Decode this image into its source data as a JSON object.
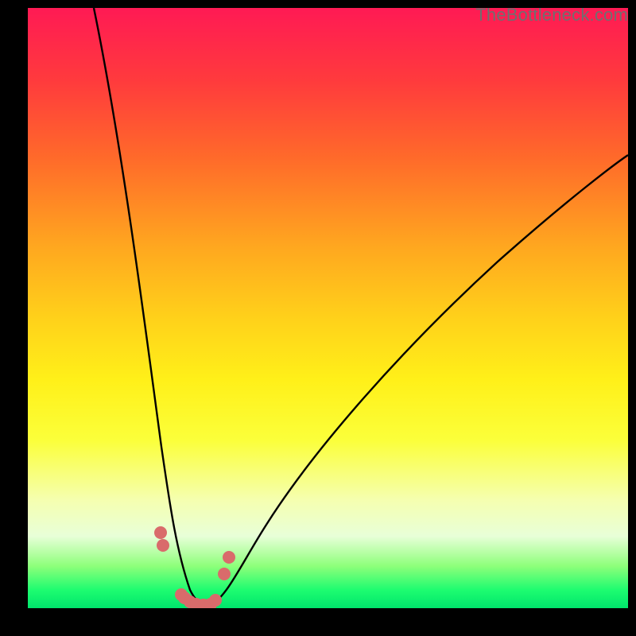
{
  "watermark": "TheBottleneck.com",
  "colors": {
    "background": "#000000",
    "curve": "#000000",
    "markers": "#d96b6b",
    "gradient_stops": [
      "#ff1a54",
      "#ff3a3d",
      "#ff6a2a",
      "#ffa81f",
      "#ffd21a",
      "#fff019",
      "#fbff3a",
      "#f5ffb0",
      "#e8ffd8",
      "#8dff7a",
      "#1dfc70",
      "#00e56c"
    ]
  },
  "chart_data": {
    "type": "line",
    "title": "",
    "xlabel": "",
    "ylabel": "",
    "xlim": [
      0,
      100
    ],
    "ylim": [
      0,
      100
    ],
    "series": [
      {
        "name": "bottleneck-curve",
        "x": [
          11,
          13,
          15,
          17,
          19,
          21,
          22,
          23,
          24,
          25,
          26,
          27,
          28,
          29,
          30,
          32,
          34,
          37,
          40,
          45,
          51,
          58,
          66,
          75,
          85,
          95,
          100
        ],
        "values": [
          100,
          89,
          78,
          67,
          56,
          44,
          37,
          30,
          22,
          14,
          7,
          3,
          1,
          0,
          0,
          1,
          3,
          6,
          10,
          17,
          25,
          33,
          42,
          51,
          60,
          68,
          72
        ]
      }
    ],
    "markers": {
      "name": "highlight-points",
      "x": [
        22.2,
        22.6,
        25.5,
        26.0,
        27.0,
        28.0,
        29.2,
        30.4,
        31.2,
        32.6,
        33.4
      ],
      "values": [
        12.5,
        10.5,
        2.2,
        1.6,
        1.0,
        0.7,
        0.5,
        0.6,
        1.2,
        5.6,
        8.4
      ]
    }
  }
}
